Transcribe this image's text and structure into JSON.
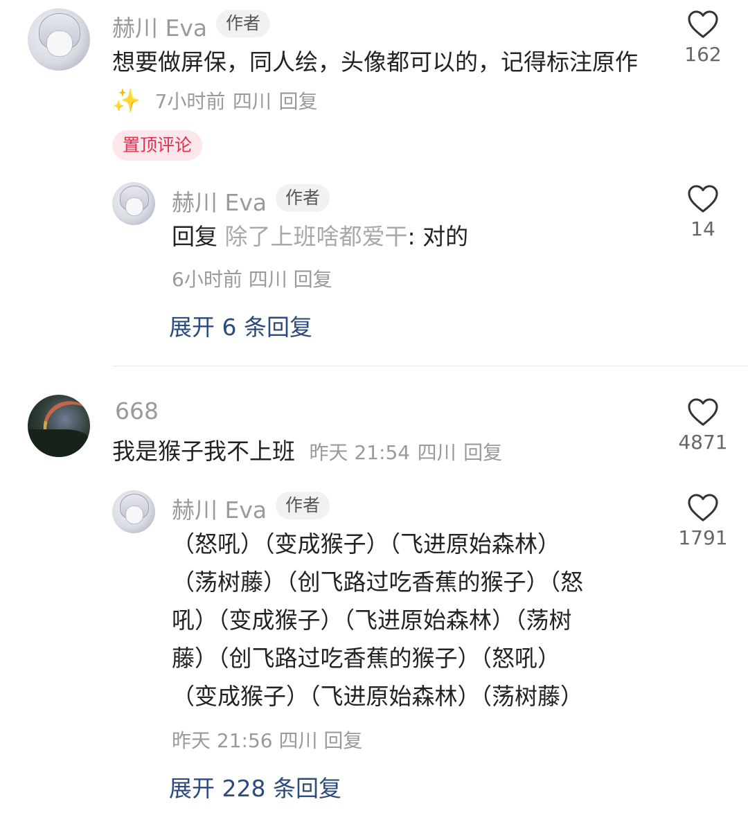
{
  "comments": [
    {
      "username": "赫川 Eva",
      "badge": "作者",
      "text": "想要做屏保，同人绘，头像都可以的，记得标注原作",
      "emoji": "✨",
      "time": "7小时前",
      "location": "四川",
      "reply_label": "回复",
      "likes": "162",
      "pinned_label": "置顶评论",
      "replies": [
        {
          "username": "赫川 Eva",
          "badge": "作者",
          "reply_prefix": "回复",
          "reply_to": "除了上班啥都爱干",
          "text": ": 对的",
          "time": "6小时前",
          "location": "四川",
          "reply_label": "回复",
          "likes": "14"
        }
      ],
      "expand_label": "展开 6 条回复"
    },
    {
      "username": "668",
      "text": "我是猴子我不上班",
      "time": "昨天 21:54",
      "location": "四川",
      "reply_label": "回复",
      "likes": "4871",
      "replies": [
        {
          "username": "赫川 Eva",
          "badge": "作者",
          "lines": [
            "（怒吼）（变成猴子）（飞进原始森林）",
            "（荡树藤）（创飞路过吃香蕉的猴子）（怒",
            "吼）（变成猴子）（飞进原始森林）（荡树",
            "藤）（创飞路过吃香蕉的猴子）（怒吼）",
            "（变成猴子）（飞进原始森林）（荡树藤）"
          ],
          "time": "昨天 21:56",
          "location": "四川",
          "reply_label": "回复",
          "likes": "1791"
        }
      ],
      "expand_label": "展开 228 条回复"
    }
  ],
  "icons": {
    "like": "heart-outline-icon",
    "sparkle": "sparkles-emoji"
  },
  "colors": {
    "pinned_bg": "#fde7ea",
    "pinned_text": "#e0304f",
    "expand_link": "#2c4a7c"
  }
}
